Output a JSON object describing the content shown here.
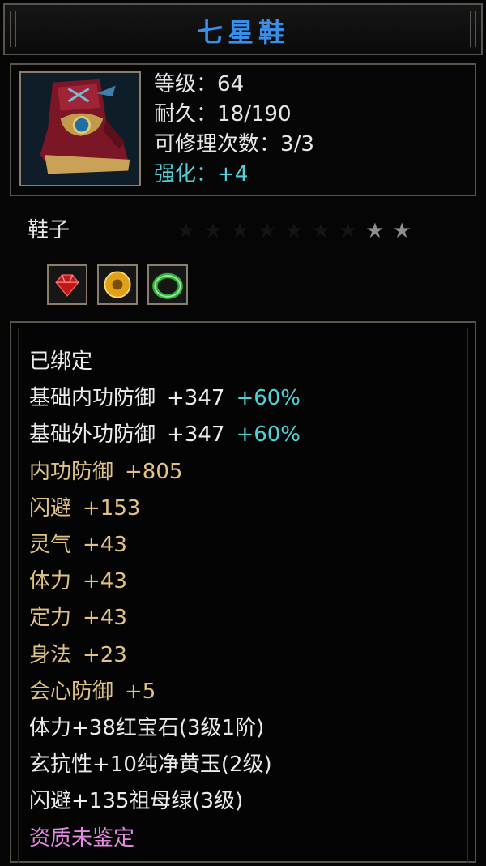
{
  "item": {
    "name": "七星鞋",
    "type": "鞋子",
    "icon": "boot-icon"
  },
  "header_stats": [
    {
      "label": "等级",
      "sep": "：",
      "value": "64",
      "color": "#e6e6e6"
    },
    {
      "label": "耐久",
      "sep": "：",
      "value": "18/190",
      "color": "#e6e6e6"
    },
    {
      "label": "可修理次数",
      "sep": "：",
      "value": "3/3",
      "color": "#e6e6e6"
    },
    {
      "label": "强化",
      "sep": "：",
      "value": "+4",
      "color": "#4fd2d8"
    }
  ],
  "stars": {
    "total": 9,
    "lit": 2
  },
  "gems": [
    {
      "name": "ruby-gem-icon",
      "color": "#d21a1a"
    },
    {
      "name": "yellow-jade-icon",
      "color": "#e8a81a"
    },
    {
      "name": "emerald-ring-icon",
      "color": "#2fb03a"
    }
  ],
  "attributes": {
    "bound": "已绑定",
    "base_lines": [
      {
        "label": "基础内功防御",
        "value": "+347",
        "bonus": "+60%"
      },
      {
        "label": "基础外功防御",
        "value": "+347",
        "bonus": "+60%"
      }
    ],
    "gold_lines": [
      {
        "label": "内功防御",
        "value": "+805"
      },
      {
        "label": "闪避",
        "value": "+153"
      },
      {
        "label": "灵气",
        "value": "+43"
      },
      {
        "label": "体力",
        "value": "+43"
      },
      {
        "label": "定力",
        "value": "+43"
      },
      {
        "label": "身法",
        "value": "+23"
      },
      {
        "label": "会心防御",
        "value": "+5"
      }
    ],
    "gem_lines": [
      "体力+38红宝石(3级1阶)",
      "玄抗性+10纯净黄玉(2级)",
      "闪避+135祖母绿(3级)"
    ],
    "quality": "资质未鉴定"
  },
  "colors": {
    "title": "#3b8ee8",
    "white": "#ececec",
    "gold": "#e0c284",
    "cyan": "#4fd2d8",
    "pink": "#e48ae2",
    "border": "#5a554c"
  }
}
